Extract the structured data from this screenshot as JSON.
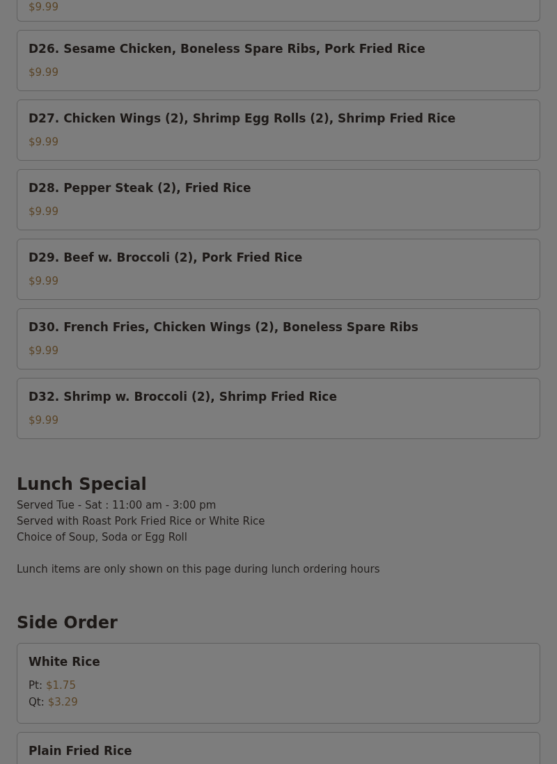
{
  "partial_item": {
    "price": "$9.99"
  },
  "combo_items": [
    {
      "name": "D26. Sesame Chicken, Boneless Spare Ribs, Pork Fried Rice",
      "price": "$9.99"
    },
    {
      "name": "D27. Chicken Wings (2), Shrimp Egg Rolls (2), Shrimp Fried Rice",
      "price": "$9.99"
    },
    {
      "name": "D28. Pepper Steak (2), Fried Rice",
      "price": "$9.99"
    },
    {
      "name": "D29. Beef w. Broccoli (2), Pork Fried Rice",
      "price": "$9.99"
    },
    {
      "name": "D30. French Fries, Chicken Wings (2), Boneless Spare Ribs",
      "price": "$9.99"
    },
    {
      "name": "D32. Shrimp w. Broccoli (2), Shrimp Fried Rice",
      "price": "$9.99"
    }
  ],
  "lunch_special": {
    "title": "Lunch Special",
    "lines": [
      "Served Tue - Sat : 11:00 am - 3:00 pm",
      "Served with Roast Pork Fried Rice or White Rice",
      "Choice of Soup, Soda or Egg Roll"
    ],
    "note": "Lunch items are only shown on this page during lunch ordering hours"
  },
  "side_order": {
    "title": "Side Order",
    "items": [
      {
        "name": "White Rice",
        "prices": [
          {
            "size": "Pt:",
            "price": "$1.75"
          },
          {
            "size": "Qt:",
            "price": "$3.29"
          }
        ]
      },
      {
        "name": "Plain Fried Rice"
      }
    ]
  }
}
